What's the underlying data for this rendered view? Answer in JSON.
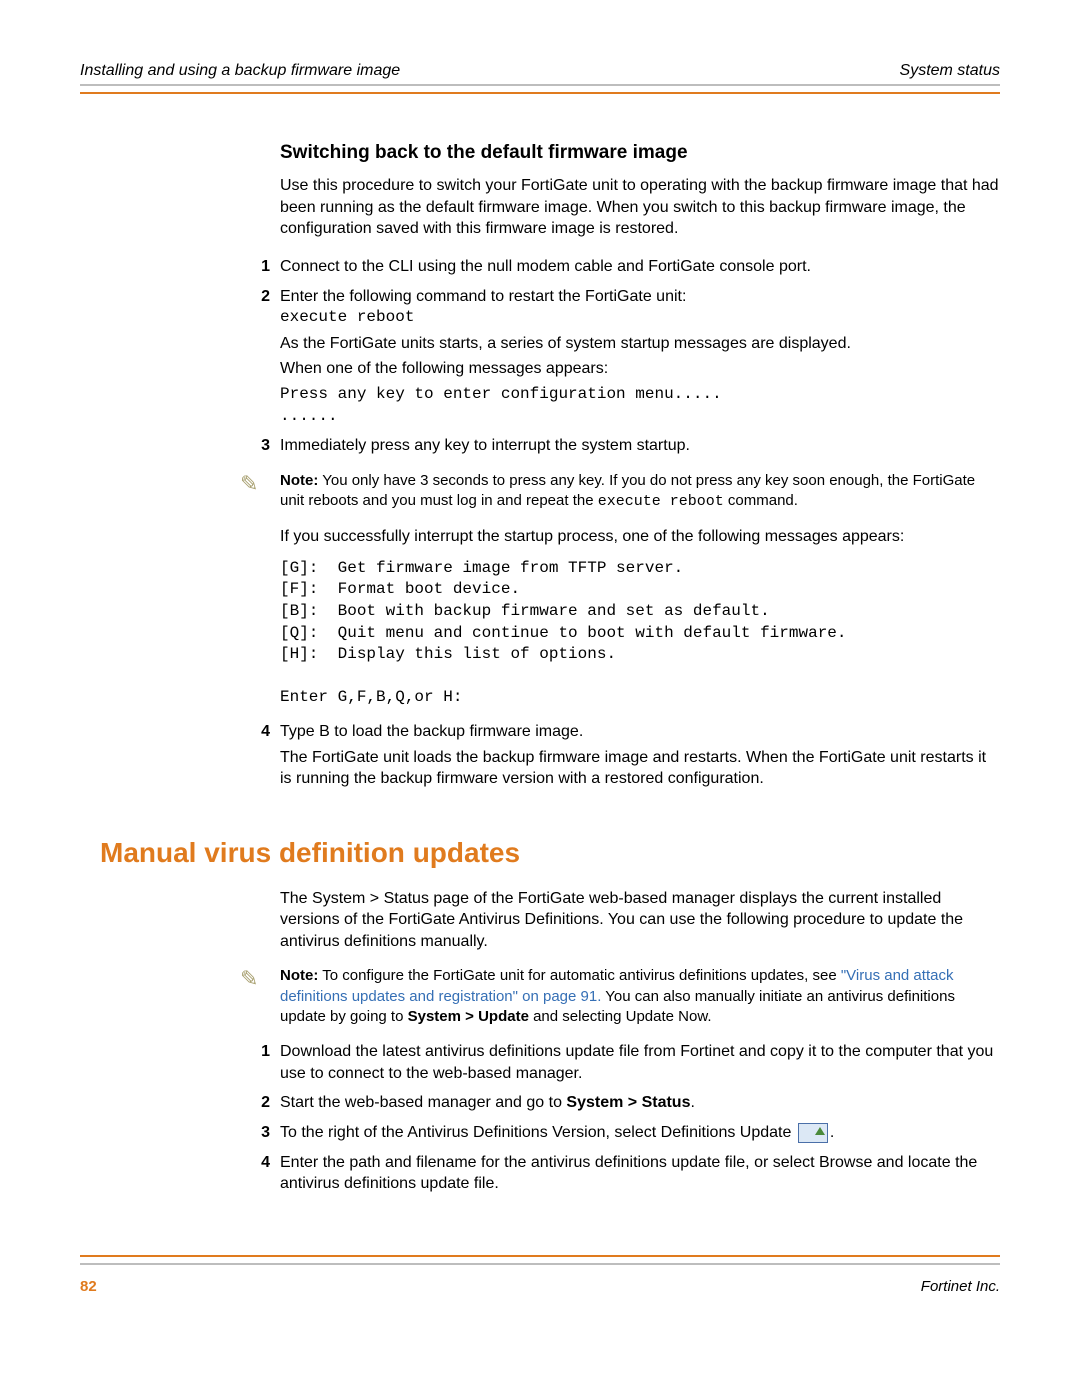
{
  "header": {
    "left": "Installing and using a backup firmware image",
    "right": "System status"
  },
  "h3_switch": "Switching back to the default firmware image",
  "switch_intro": "Use this procedure to switch your FortiGate unit to operating with the backup firmware image that had been running as the default firmware image. When you switch to this backup firmware image, the configuration saved with this firmware image is restored.",
  "steps_a": {
    "s1": {
      "n": "1",
      "t": "Connect to the CLI using the null modem cable and FortiGate console port."
    },
    "s2": {
      "n": "2",
      "t": "Enter the following command to restart the FortiGate unit:"
    },
    "s2_code": "execute reboot",
    "s2_p1": "As the FortiGate units starts, a series of system startup messages are displayed.",
    "s2_p2": "When one of the following messages appears:",
    "s2_code2": "Press any key to enter configuration menu.....\n......",
    "s3": {
      "n": "3",
      "t": "Immediately press any key to interrupt the system startup."
    }
  },
  "note1": {
    "lead": "Note:",
    "body": " You only have 3 seconds to press any key. If you do not press any key soon enough, the FortiGate unit reboots and you must log in and repeat the ",
    "code": "execute reboot",
    "tail": " command."
  },
  "after_note_p": "If you successfully interrupt the startup process, one of the following messages appears:",
  "menu_block": "[G]:  Get firmware image from TFTP server.\n[F]:  Format boot device.\n[B]:  Boot with backup firmware and set as default.\n[Q]:  Quit menu and continue to boot with default firmware.\n[H]:  Display this list of options.\n\nEnter G,F,B,Q,or H:",
  "steps_b": {
    "s4": {
      "n": "4",
      "t": "Type B to load the backup firmware image."
    },
    "s4_p": "The FortiGate unit loads the backup firmware image and restarts. When the FortiGate unit restarts it is running the backup firmware version with a restored configuration."
  },
  "h2_manual": "Manual virus definition updates",
  "manual_intro": "The System > Status page of the FortiGate web-based manager displays the current installed versions of the FortiGate Antivirus Definitions. You can use the following procedure to update the antivirus definitions manually.",
  "note2": {
    "lead": "Note:",
    "p1": " To configure the FortiGate unit for automatic antivirus definitions updates, see ",
    "link": "\"Virus and attack definitions updates and registration\" on page 91.",
    "p2": " You can also manually initiate an antivirus definitions update by going to ",
    "bold": "System > Update",
    "p3": " and selecting Update Now."
  },
  "steps_c": {
    "s1": {
      "n": "1",
      "t": "Download the latest antivirus definitions update file from Fortinet and copy it to the computer that you use to connect to the web-based manager."
    },
    "s2": {
      "n": "2",
      "pre": "Start the web-based manager and go to ",
      "bold": "System > Status",
      "post": "."
    },
    "s3": {
      "n": "3",
      "t_pre": "To the right of the Antivirus Definitions Version, select Definitions Update ",
      "t_post": "."
    },
    "s4": {
      "n": "4",
      "t": "Enter the path and filename for the antivirus definitions update file, or select Browse and locate the antivirus definitions update file."
    }
  },
  "footer": {
    "page": "82",
    "right": "Fortinet Inc."
  }
}
